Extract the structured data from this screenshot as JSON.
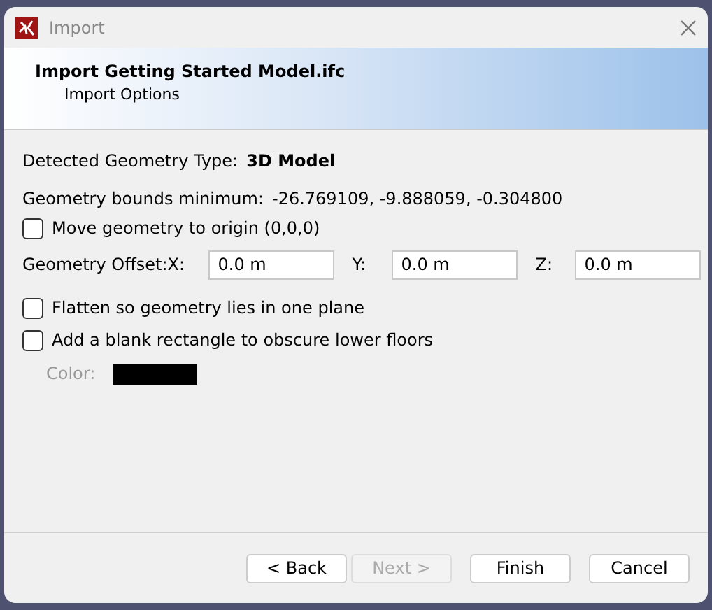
{
  "window": {
    "title": "Import"
  },
  "header": {
    "title": "Import Getting Started Model.ifc",
    "subtitle": "Import Options"
  },
  "detected_type": {
    "label": "Detected Geometry Type:",
    "value": "3D Model"
  },
  "bounds": {
    "label": "Geometry bounds minimum:",
    "value": "-26.769109, -9.888059, -0.304800"
  },
  "move_to_origin": {
    "label": "Move geometry to origin (0,0,0)",
    "checked": false
  },
  "offset": {
    "label": "Geometry Offset:",
    "fields": [
      {
        "label": "X:",
        "value": "0.0 m"
      },
      {
        "label": "Y:",
        "value": "0.0 m"
      },
      {
        "label": "Z:",
        "value": "0.0 m"
      }
    ]
  },
  "options": [
    {
      "label": "Flatten so geometry lies in one plane",
      "checked": false
    },
    {
      "label": "Add a blank rectangle to obscure lower floors",
      "checked": false
    }
  ],
  "color": {
    "label": "Color:",
    "disabled": true,
    "color": "#000000"
  },
  "buttons": [
    {
      "label": "< Back",
      "disabled": false
    },
    {
      "label": "Next >",
      "disabled": true
    },
    {
      "label": "Finish",
      "disabled": false
    },
    {
      "label": "Cancel",
      "disabled": false
    }
  ]
}
